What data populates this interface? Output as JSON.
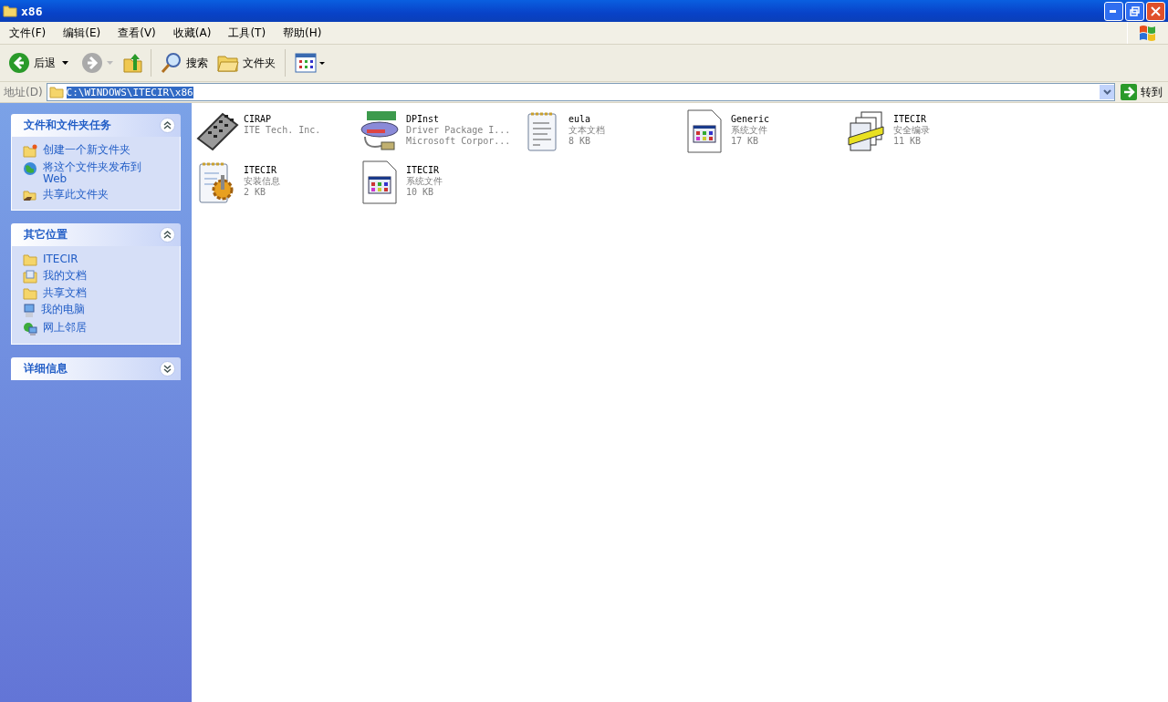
{
  "window": {
    "title": "x86"
  },
  "menu": [
    {
      "label": "文件(F)"
    },
    {
      "label": "编辑(E)"
    },
    {
      "label": "查看(V)"
    },
    {
      "label": "收藏(A)"
    },
    {
      "label": "工具(T)"
    },
    {
      "label": "帮助(H)"
    }
  ],
  "toolbar": {
    "back": "后退",
    "search": "搜索",
    "folders": "文件夹"
  },
  "address": {
    "label": "地址(D)",
    "value": "C:\\WINDOWS\\ITECIR\\x86",
    "selected": true,
    "go": "转到"
  },
  "panels": [
    {
      "title": "文件和文件夹任务",
      "expanded": true,
      "items": [
        {
          "label": "创建一个新文件夹",
          "kind": "new-folder"
        },
        {
          "label": "将这个文件夹发布到 Web",
          "kind": "globe"
        },
        {
          "label": "共享此文件夹",
          "kind": "share"
        }
      ]
    },
    {
      "title": "其它位置",
      "expanded": true,
      "items": [
        {
          "label": "ITECIR",
          "kind": "folder"
        },
        {
          "label": "我的文档",
          "kind": "documents"
        },
        {
          "label": "共享文档",
          "kind": "folder"
        },
        {
          "label": "我的电脑",
          "kind": "computer"
        },
        {
          "label": "网上邻居",
          "kind": "network"
        }
      ]
    },
    {
      "title": "详细信息",
      "expanded": false
    }
  ],
  "files": [
    {
      "name": "CIRAP",
      "lines": [
        "ITE Tech. Inc."
      ],
      "kind": "remote"
    },
    {
      "name": "DPInst",
      "lines": [
        "Driver Package I...",
        "Microsoft Corpor..."
      ],
      "kind": "driver"
    },
    {
      "name": "eula",
      "lines": [
        "文本文档",
        "8 KB"
      ],
      "kind": "text"
    },
    {
      "name": "Generic",
      "lines": [
        "系统文件",
        "17 KB"
      ],
      "kind": "system"
    },
    {
      "name": "ITECIR",
      "lines": [
        "安全编录",
        "11 KB"
      ],
      "kind": "catalog"
    },
    {
      "name": "ITECIR",
      "lines": [
        "安装信息",
        "2 KB"
      ],
      "kind": "setup"
    },
    {
      "name": "ITECIR",
      "lines": [
        "系统文件",
        "10 KB"
      ],
      "kind": "system"
    }
  ]
}
